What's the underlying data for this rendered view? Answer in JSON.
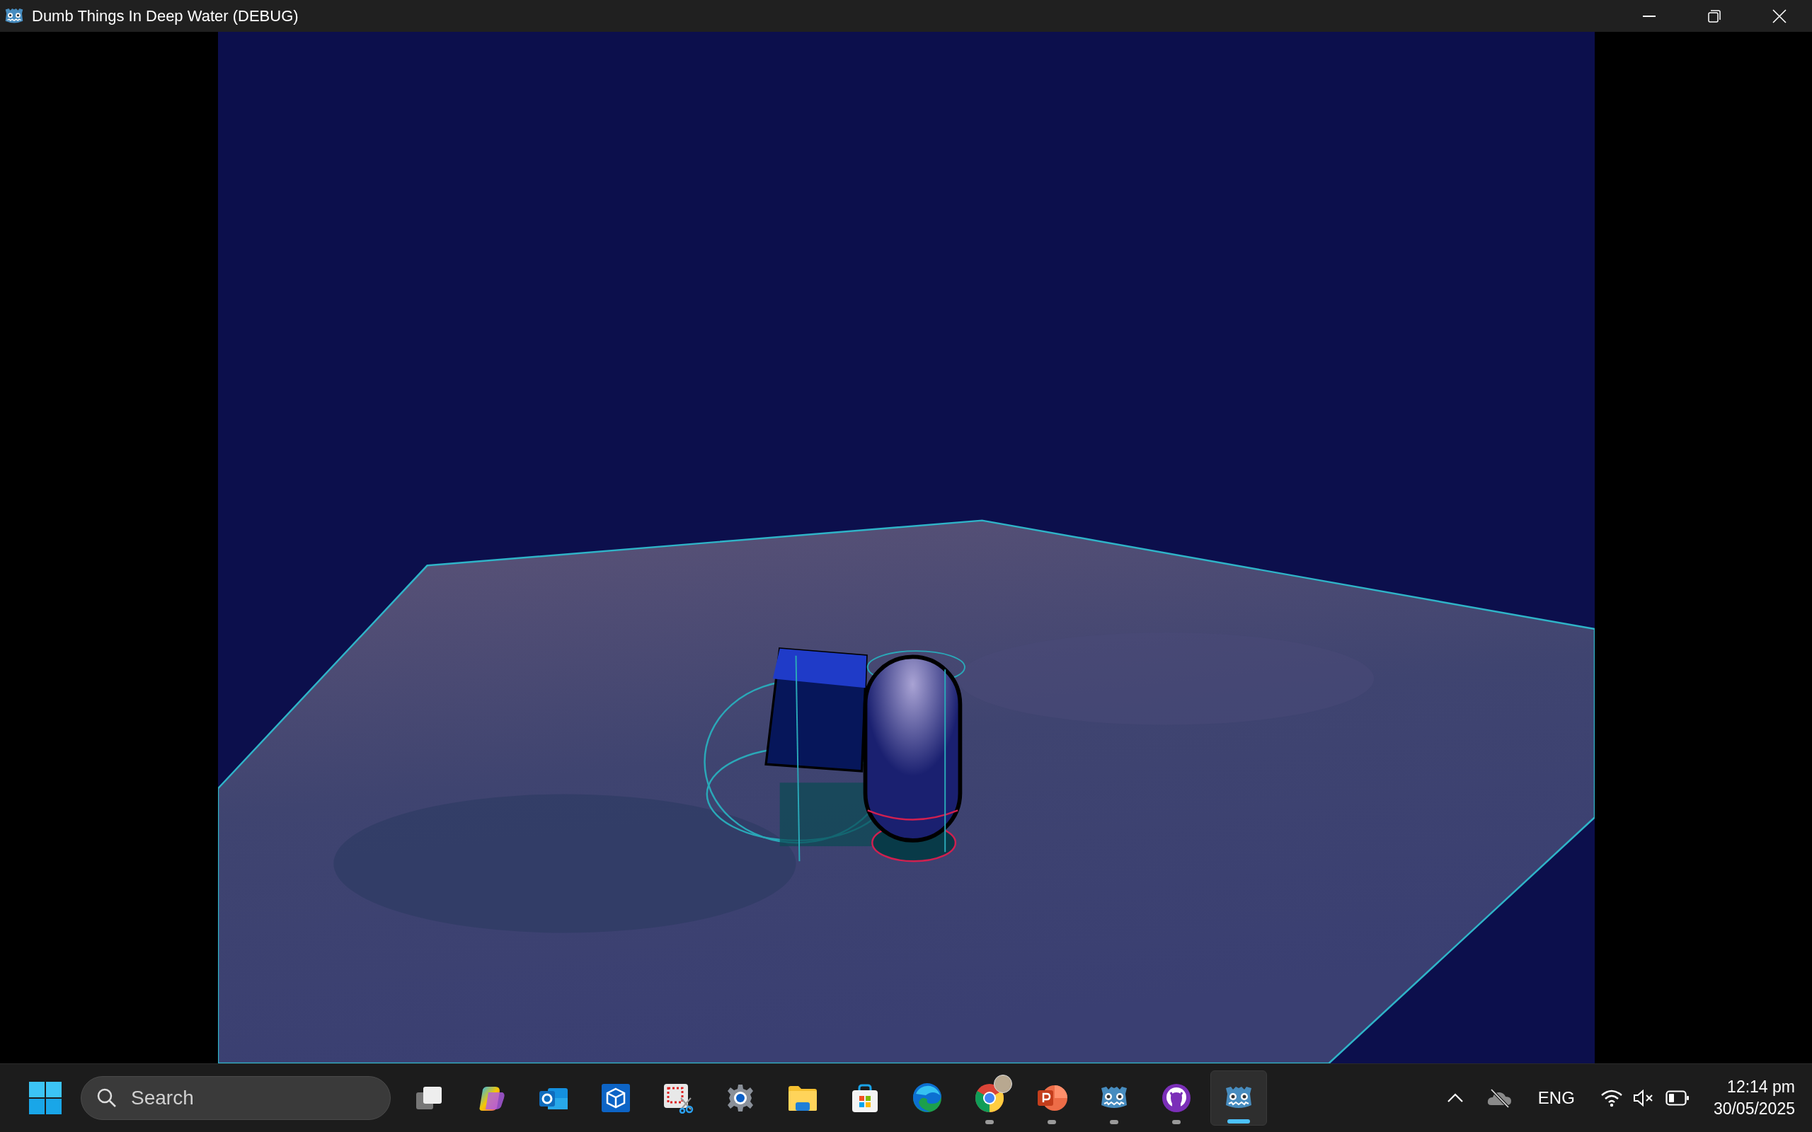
{
  "window": {
    "title": "Dumb Things In Deep Water (DEBUG)"
  },
  "taskbar": {
    "search": {
      "placeholder": "Search"
    },
    "apps": [
      {
        "running": false,
        "selected": false
      },
      {
        "running": false,
        "selected": false
      },
      {
        "running": false,
        "selected": false
      },
      {
        "running": false,
        "selected": false
      },
      {
        "running": false,
        "selected": false
      },
      {
        "running": false,
        "selected": false
      },
      {
        "running": false,
        "selected": false
      },
      {
        "running": false,
        "selected": false
      },
      {
        "running": false,
        "selected": false
      },
      {
        "running": true,
        "selected": false
      },
      {
        "running": true,
        "selected": false
      },
      {
        "running": true,
        "selected": false
      },
      {
        "running": true,
        "selected": false
      },
      {
        "running": true,
        "selected": true
      }
    ],
    "tray": {
      "language": "ENG",
      "volume_muted": true,
      "time": "12:14 pm",
      "date": "30/05/2025"
    }
  }
}
